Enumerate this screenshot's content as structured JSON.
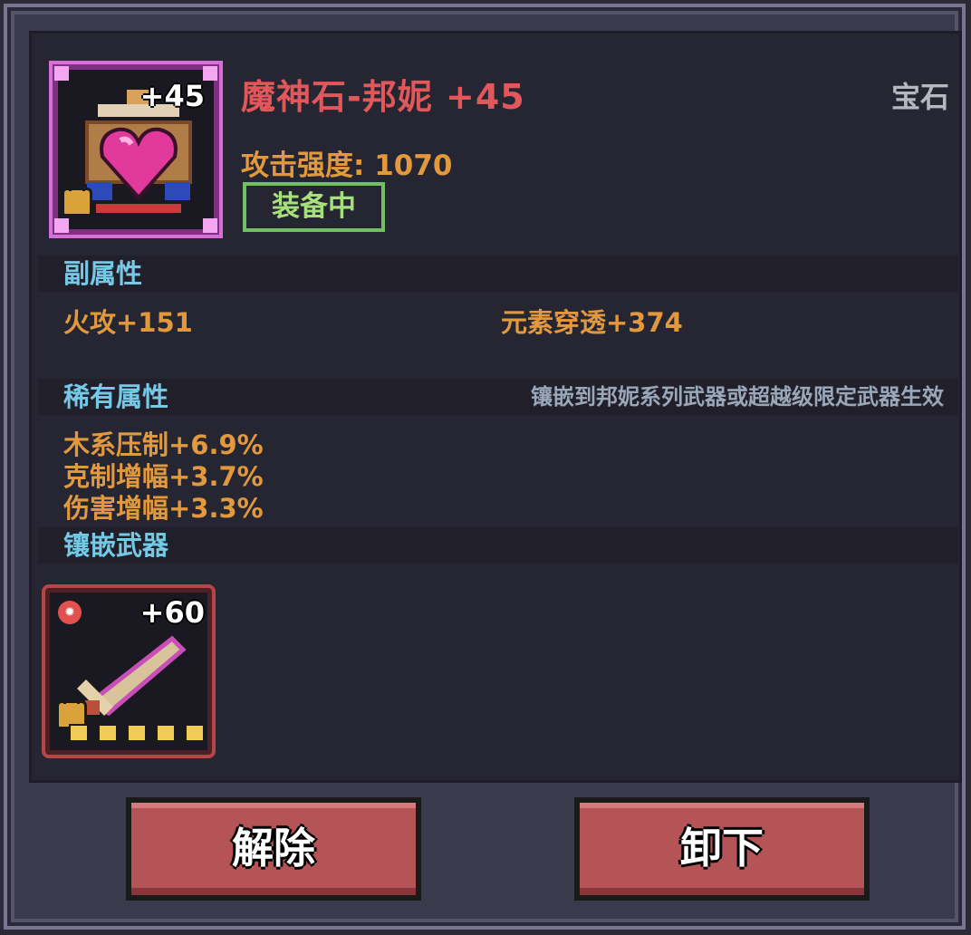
{
  "gem": {
    "name": "魔神石-邦妮 +45",
    "type": "宝石",
    "level": "+45",
    "attack": "攻击强度: 1070",
    "status": "装备中",
    "icon": "heart-gem-icon"
  },
  "sub_attributes": {
    "title": "副属性",
    "items": [
      "火攻+151",
      "元素穿透+374"
    ]
  },
  "rare_attributes": {
    "title": "稀有属性",
    "note": "镶嵌到邦妮系列武器或超越级限定武器生效",
    "items": [
      "木系压制+6.9%",
      "克制增幅+3.7%",
      "伤害增幅+3.3%"
    ]
  },
  "inlaid_weapon": {
    "title": "镶嵌武器",
    "level": "+60",
    "stars": 5,
    "icon": "sword-icon"
  },
  "buttons": {
    "remove": "解除",
    "unequip": "卸下"
  },
  "colors": {
    "title": "#e2585a",
    "stat": "#e2993e",
    "section": "#75c8e6",
    "equipped": "#72c062",
    "button": "#b55457"
  }
}
